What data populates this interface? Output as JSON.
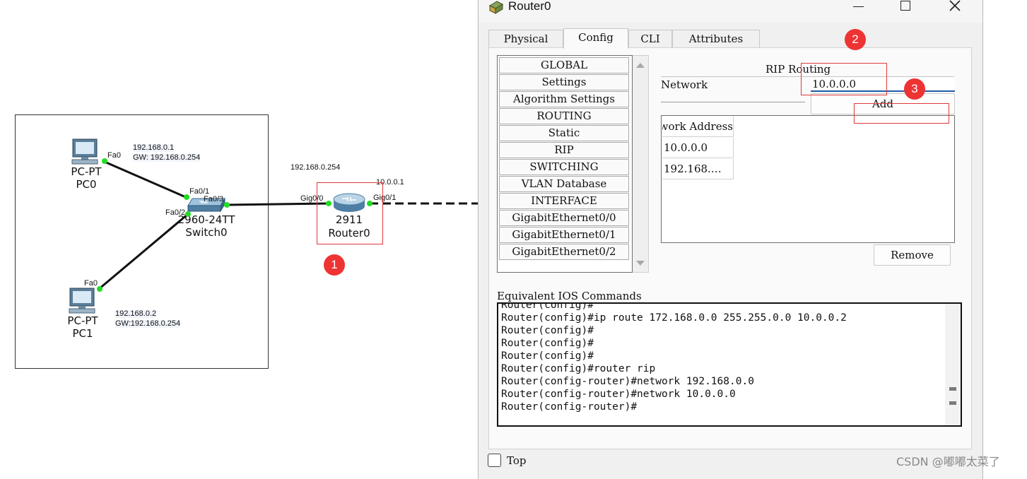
{
  "topology": {
    "pc0": {
      "type": "PC-PT",
      "name": "PC0",
      "ip_line": "192.168.0.1",
      "gw_line": "GW: 192.168.0.254",
      "port": "Fa0"
    },
    "pc1": {
      "type": "PC-PT",
      "name": "PC1",
      "ip_line": "192.168.0.2",
      "gw_line": "GW:192.168.0.254",
      "port": "Fa0"
    },
    "switch0": {
      "model": "2960-24TT",
      "name": "Switch0",
      "ports": [
        "Fa0/1",
        "Fa0/2",
        "Fa0/3"
      ]
    },
    "router0": {
      "model": "2911",
      "name": "Router0",
      "ports": [
        "Gig0/0",
        "Gig0/1"
      ],
      "lan_ip": "192.168.0.254",
      "wan_ip": "10.0.0.1"
    }
  },
  "badges": [
    "1",
    "2",
    "3"
  ],
  "window": {
    "title": "Router0",
    "tabs": [
      "Physical",
      "Config",
      "CLI",
      "Attributes"
    ],
    "active_tab": "Config",
    "nav": [
      "GLOBAL",
      "Settings",
      "Algorithm Settings",
      "ROUTING",
      "Static",
      "RIP",
      "SWITCHING",
      "VLAN Database",
      "INTERFACE",
      "GigabitEthernet0/0",
      "GigabitEthernet0/1",
      "GigabitEthernet0/2"
    ],
    "rip": {
      "heading": "RIP Routing",
      "network_label": "Network",
      "network_value": "10.0.0.0",
      "add_label": "Add",
      "table_header": "Network Address",
      "table_rows": [
        "10.0.0.0",
        "192.168.…"
      ],
      "remove_label": "Remove"
    },
    "ios": {
      "label": "Equivalent IOS Commands",
      "lines": [
        "Router(config)#",
        "Router(config)#ip route 172.168.0.0 255.255.0.0 10.0.0.2",
        "Router(config)#",
        "Router(config)#",
        "Router(config)#",
        "Router(config)#router rip",
        "Router(config-router)#network 192.168.0.0",
        "Router(config-router)#network 10.0.0.0",
        "Router(config-router)#"
      ]
    },
    "top_checkbox": {
      "label": "Top",
      "checked": false
    }
  },
  "watermark": "CSDN @嘟嘟太菜了",
  "colors": {
    "link_dot": "#22dd22",
    "badge": "#ee3333",
    "highlight_box": "#e03a3a"
  }
}
